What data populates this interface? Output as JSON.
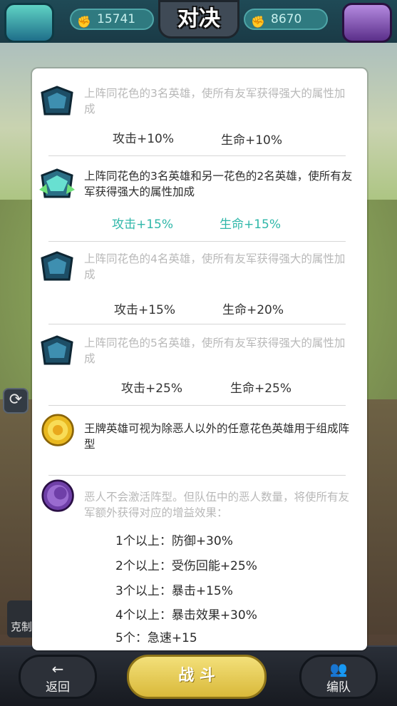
{
  "header": {
    "title": "对决",
    "left_power": "15741",
    "right_power": "8670"
  },
  "side_buttons": {
    "refresh_icon": "refresh-icon"
  },
  "bottom": {
    "back_label": "返回",
    "fight_label": "战 斗",
    "team_label": "编队",
    "left_partial": "克制"
  },
  "dialog": {
    "rows": [
      {
        "text": "上阵同花色的3名英雄，使所有友军获得强大的属性加成",
        "attack": "攻击+10%",
        "hp": "生命+10%",
        "active": false
      },
      {
        "text": "上阵同花色的3名英雄和另一花色的2名英雄，使所有友军获得强大的属性加成",
        "attack": "攻击+15%",
        "hp": "生命+15%",
        "active": true
      },
      {
        "text": "上阵同花色的4名英雄，使所有友军获得强大的属性加成",
        "attack": "攻击+15%",
        "hp": "生命+20%",
        "active": false
      },
      {
        "text": "上阵同花色的5名英雄，使所有友军获得强大的属性加成",
        "attack": "攻击+25%",
        "hp": "生命+25%",
        "active": false
      }
    ],
    "ace": {
      "text": "王牌英雄可视为除恶人以外的任意花色英雄用于组成阵型"
    },
    "villain": {
      "text": "恶人不会激活阵型。但队伍中的恶人数量，将使所有友军额外获得对应的增益效果：",
      "lines": [
        "1个以上：防御+30%",
        "2个以上：受伤回能+25%",
        "3个以上：暴击+15%",
        "4个以上：暴击效果+30%",
        "5个：急速+15"
      ]
    }
  },
  "colors": {
    "active_stat": "#2fb7a9",
    "inactive_text": "#b8b8b8"
  }
}
